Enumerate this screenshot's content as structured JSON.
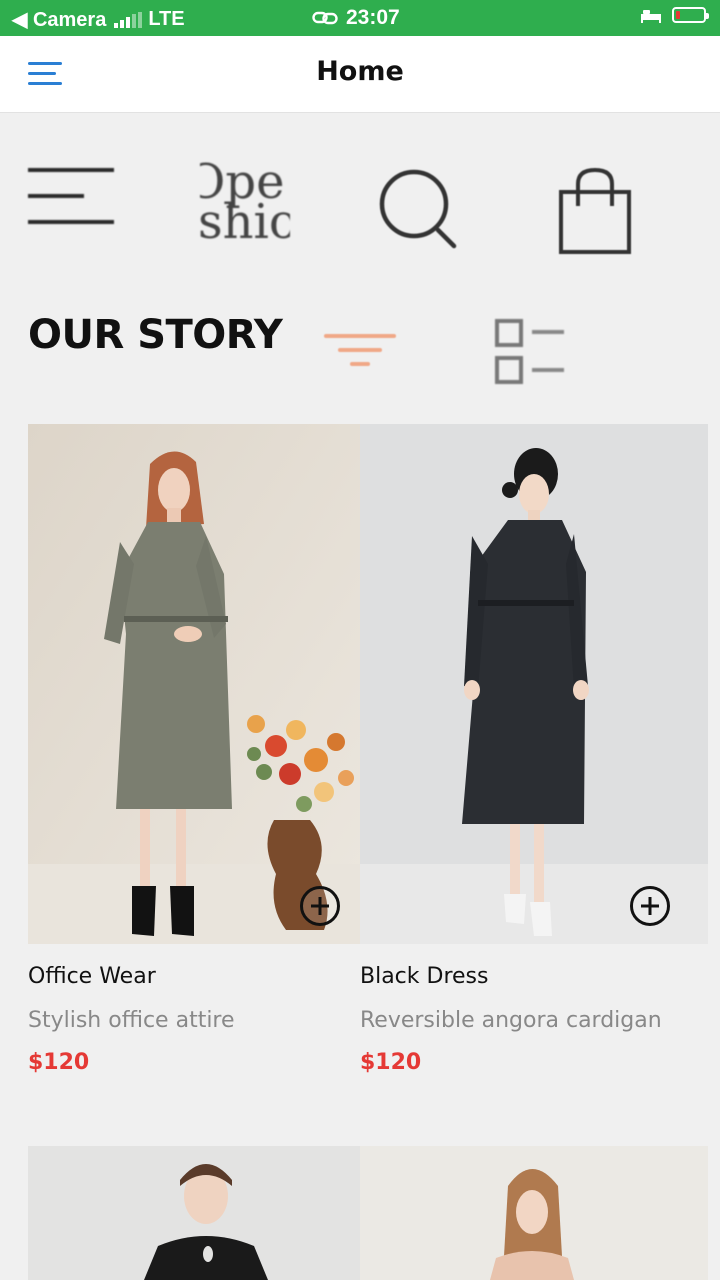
{
  "status_bar": {
    "back_label": "◀ Camera",
    "network": "LTE",
    "time": "23:07",
    "bar_color": "#2fae4e",
    "battery_color": "#e53935"
  },
  "nav": {
    "title": "Home",
    "menu_icon": "hamburger-menu-icon",
    "accent": "#2a7fd4"
  },
  "brand_bar": {
    "logo_line1": "Ope",
    "logo_line2": "shio",
    "icons": [
      "menu-icon",
      "search-icon",
      "shopping-bag-icon"
    ]
  },
  "section": {
    "title": "OUR STORY",
    "filter_icon": "filter-icon",
    "view_icon": "list-view-icon",
    "filter_color": "#f0a887"
  },
  "products": [
    {
      "name": "Office Wear",
      "description": "Stylish office attire",
      "price": "$120"
    },
    {
      "name": "Black Dress",
      "description": "Reversible angora cardigan",
      "price": "$120"
    }
  ],
  "colors": {
    "price": "#e53935",
    "description": "#888888",
    "background": "#f0f0f0"
  }
}
